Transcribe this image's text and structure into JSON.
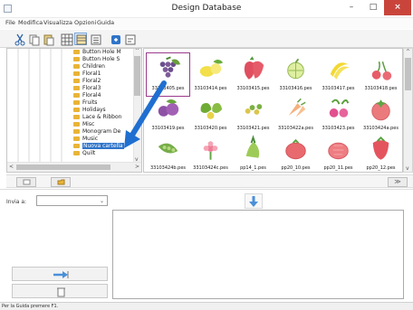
{
  "window": {
    "title": "Design Database",
    "minimize_label": "–",
    "maximize_label": "□",
    "close_label": "×"
  },
  "menu": {
    "items": [
      "File",
      "Modifica",
      "Visualizza",
      "Opzioni",
      "Guida"
    ]
  },
  "toolbar": {
    "buttons": [
      "cut-icon",
      "copy-icon",
      "paste-icon",
      "large-icons-view-icon",
      "small-icons-view-icon",
      "details-view-icon",
      "send-to-card-icon",
      "properties-icon"
    ],
    "active_view": "small-icons-view-icon"
  },
  "tree": {
    "items": [
      {
        "label": "Button Hole M",
        "selected": false
      },
      {
        "label": "Button Hole S",
        "selected": false
      },
      {
        "label": "Children",
        "selected": false
      },
      {
        "label": "Floral1",
        "selected": false
      },
      {
        "label": "Floral2",
        "selected": false
      },
      {
        "label": "Floral3",
        "selected": false
      },
      {
        "label": "Floral4",
        "selected": false
      },
      {
        "label": "Fruits",
        "selected": false
      },
      {
        "label": "Holidays",
        "selected": false
      },
      {
        "label": "Lace & Ribbon",
        "selected": false
      },
      {
        "label": "Misc",
        "selected": false
      },
      {
        "label": "Monogram De",
        "selected": false
      },
      {
        "label": "Music",
        "selected": false
      },
      {
        "label": "Nuova cartella",
        "selected": true
      },
      {
        "label": "Quilt",
        "selected": false
      }
    ],
    "scroll_left": "<",
    "scroll_right": ">",
    "scroll_up": "^",
    "scroll_down": "v"
  },
  "thumbnails": {
    "rows": [
      [
        {
          "file": "33103405.pes",
          "motif": "grapes",
          "selected": true
        },
        {
          "file": "33103414.pes",
          "motif": "lemon"
        },
        {
          "file": "33103415.pes",
          "motif": "strawberry"
        },
        {
          "file": "33103416.pes",
          "motif": "melon"
        },
        {
          "file": "33103417.pes",
          "motif": "bananas"
        },
        {
          "file": "33103418.pes",
          "motif": "cherries"
        }
      ],
      [
        {
          "file": "33103419.pes",
          "motif": "plums"
        },
        {
          "file": "33103420.pes",
          "motif": "pears"
        },
        {
          "file": "33103421.pes",
          "motif": "berries"
        },
        {
          "file": "33103422a.pes",
          "motif": "carrots"
        },
        {
          "file": "33103423.pes",
          "motif": "radishes"
        },
        {
          "file": "33103424a.pes",
          "motif": "tomato"
        }
      ],
      [
        {
          "file": "33103424b.pes",
          "motif": "pea-pod"
        },
        {
          "file": "33103424c.pes",
          "motif": "flower"
        },
        {
          "file": "pp14_1.pes",
          "motif": "vegetable"
        },
        {
          "file": "pp20_10.pes",
          "motif": "tomato"
        },
        {
          "file": "pp20_11.pes",
          "motif": "tomato"
        },
        {
          "file": "pp20_12.pes",
          "motif": "strawberry"
        }
      ]
    ]
  },
  "midbar": {
    "buttons": [
      "new-folder-button",
      "open-folder-button"
    ],
    "collapse_label": "≫"
  },
  "send_panel": {
    "label": "Invia a:",
    "selected_value": "",
    "chevron": "⌄"
  },
  "status": {
    "text": "Per la Guida premere F1."
  },
  "colors": {
    "accent": "#2f74c9",
    "folder": "#e9b437",
    "close": "#c9453c",
    "selection_outline": "#9a3b8b",
    "arrow": "#1f6fd1"
  }
}
